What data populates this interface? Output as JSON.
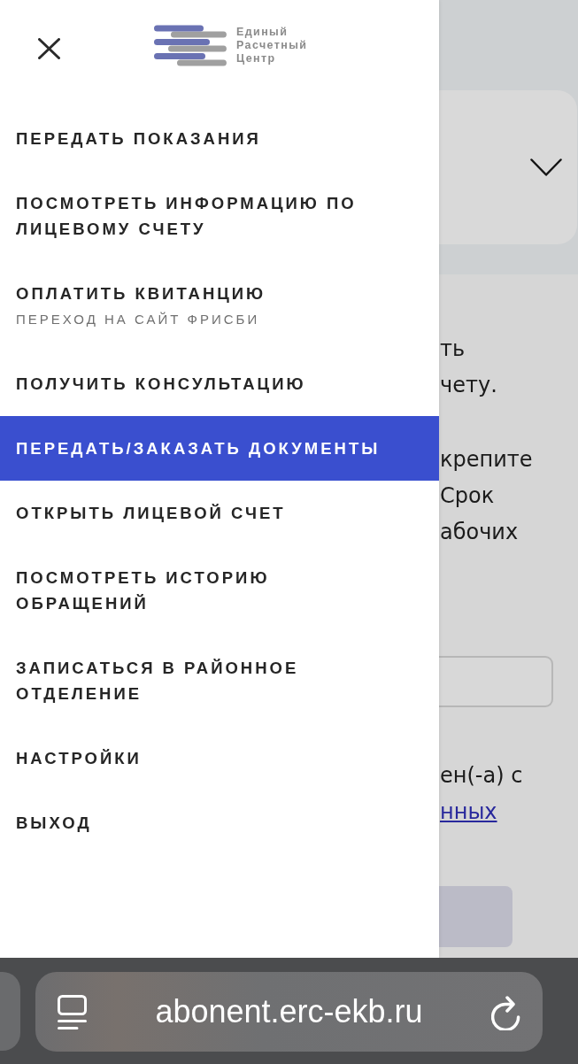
{
  "drawer": {
    "logo": {
      "lines": [
        "Единый",
        "Расчетный",
        "Центр"
      ]
    },
    "menu": [
      {
        "label": "ПЕРЕДАТЬ ПОКАЗАНИЯ",
        "selected": false
      },
      {
        "label": "ПОСМОТРЕТЬ ИНФОРМАЦИЮ ПО ЛИЦЕВОМУ СЧЕТУ",
        "selected": false
      },
      {
        "label": "ОПЛАТИТЬ КВИТАНЦИЮ",
        "subtitle": "ПЕРЕХОД НА САЙТ ФРИСБИ",
        "selected": false
      },
      {
        "label": "ПОЛУЧИТЬ КОНСУЛЬТАЦИЮ",
        "selected": false
      },
      {
        "label": "ПЕРЕДАТЬ/ЗАКАЗАТЬ ДОКУМЕНТЫ",
        "selected": true
      },
      {
        "label": "ОТКРЫТЬ ЛИЦЕВОЙ СЧЕТ",
        "selected": false
      },
      {
        "label": "ПОСМОТРЕТЬ ИСТОРИЮ ОБРАЩЕНИЙ",
        "selected": false
      },
      {
        "label": "ЗАПИСАТЬСЯ В РАЙОННОЕ ОТДЕЛЕНИЕ",
        "selected": false
      },
      {
        "label": "НАСТРОЙКИ",
        "selected": false
      },
      {
        "label": "ВЫХОД",
        "selected": false
      }
    ]
  },
  "page": {
    "paragraphs": [
      {
        "lines": [
          "ть",
          "чету."
        ]
      },
      {
        "lines": [
          "крепите",
          "Срок",
          "абочих"
        ]
      }
    ],
    "consent": {
      "text": "ен(-а) с",
      "link": "нных"
    }
  },
  "browser_bar": {
    "url": "abonent.erc-ekb.ru"
  }
}
